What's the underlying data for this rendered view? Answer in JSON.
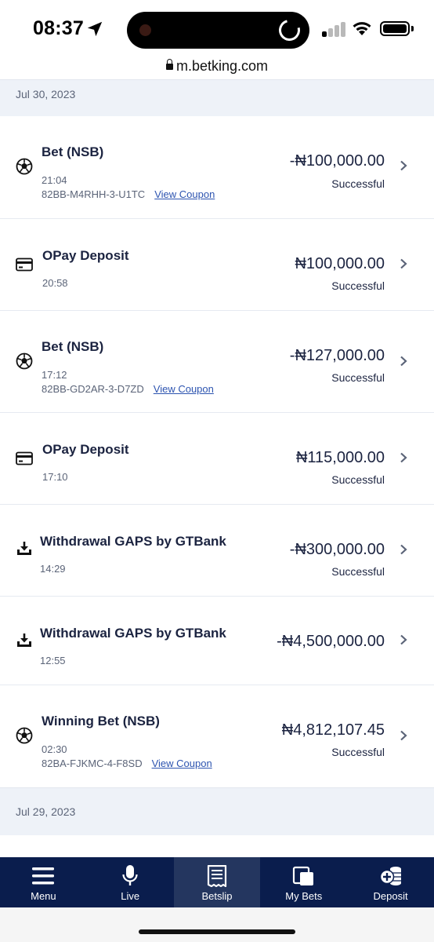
{
  "status_bar": {
    "time": "08:37"
  },
  "browser": {
    "url": "m.betking.com"
  },
  "groups": [
    {
      "date": "Jul 30, 2023",
      "transactions": [
        {
          "icon": "soccer-ball-icon",
          "title": "Bet (NSB)",
          "time": "21:04",
          "ref": "82BB-M4RHH-3-U1TC",
          "link": "View Coupon",
          "amount": "-₦100,000.00",
          "status": "Successful"
        },
        {
          "icon": "card-icon",
          "title": "OPay Deposit",
          "time": "20:58",
          "ref": "",
          "link": "",
          "amount": "₦100,000.00",
          "status": "Successful"
        },
        {
          "icon": "soccer-ball-icon",
          "title": "Bet (NSB)",
          "time": "17:12",
          "ref": "82BB-GD2AR-3-D7ZD",
          "link": "View Coupon",
          "amount": "-₦127,000.00",
          "status": "Successful"
        },
        {
          "icon": "card-icon",
          "title": "OPay Deposit",
          "time": "17:10",
          "ref": "",
          "link": "",
          "amount": "₦115,000.00",
          "status": "Successful"
        },
        {
          "icon": "download-icon",
          "title": "Withdrawal GAPS by GTBank",
          "time": "14:29",
          "ref": "",
          "link": "",
          "amount": "-₦300,000.00",
          "status": "Successful"
        },
        {
          "icon": "download-icon",
          "title": "Withdrawal GAPS by GTBank",
          "time": "12:55",
          "ref": "",
          "link": "",
          "amount": "-₦4,500,000.00",
          "status": ""
        },
        {
          "icon": "soccer-ball-icon",
          "title": "Winning Bet (NSB)",
          "time": "02:30",
          "ref": "82BA-FJKMC-4-F8SD",
          "link": "View Coupon",
          "amount": "₦4,812,107.45",
          "status": "Successful"
        }
      ]
    },
    {
      "date": "Jul 29, 2023",
      "transactions": []
    }
  ],
  "bottom_nav": [
    {
      "label": "Menu",
      "icon": "menu-icon"
    },
    {
      "label": "Live",
      "icon": "microphone-icon"
    },
    {
      "label": "Betslip",
      "icon": "betslip-icon",
      "active": true
    },
    {
      "label": "My Bets",
      "icon": "my-bets-icon"
    },
    {
      "label": "Deposit",
      "icon": "deposit-coins-icon"
    }
  ],
  "colors": {
    "nav_bg": "#0a1d4d",
    "nav_active": "#24365f",
    "link": "#2d54b0",
    "date_bg": "#eef2f8",
    "text": "#1b2340"
  }
}
